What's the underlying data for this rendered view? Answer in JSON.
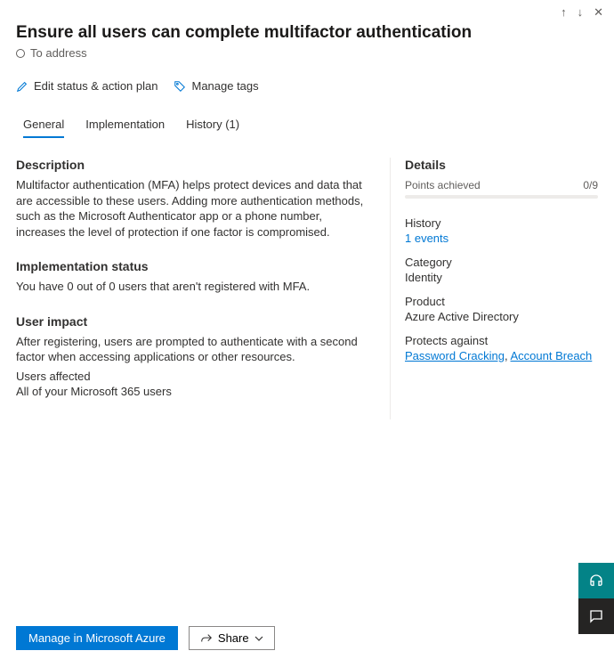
{
  "topbar": {
    "up": "↑",
    "down": "↓",
    "close": "✕"
  },
  "header": {
    "title": "Ensure all users can complete multifactor authentication",
    "status": "To address"
  },
  "actions": {
    "edit": "Edit status & action plan",
    "tags": "Manage tags"
  },
  "tabs": {
    "general": "General",
    "implementation": "Implementation",
    "history": "History (1)"
  },
  "description": {
    "heading": "Description",
    "text": "Multifactor authentication (MFA) helps protect devices and data that are accessible to these users. Adding more authentication methods, such as the Microsoft Authenticator app or a phone number, increases the level of protection if one factor is compromised."
  },
  "implStatus": {
    "heading": "Implementation status",
    "text": "You have 0 out of 0 users that aren't registered with MFA."
  },
  "userImpact": {
    "heading": "User impact",
    "text": "After registering, users are prompted to authenticate with a second factor when accessing applications or other resources.",
    "affectedLabel": "Users affected",
    "affectedValue": "All of your Microsoft 365 users"
  },
  "details": {
    "heading": "Details",
    "pointsLabel": "Points achieved",
    "pointsValue": "0/9",
    "historyLabel": "History",
    "historyLink": "1 events",
    "categoryLabel": "Category",
    "categoryValue": "Identity",
    "productLabel": "Product",
    "productValue": "Azure Active Directory",
    "protectsLabel": "Protects against",
    "protectsLink1": "Password Cracking",
    "protectsSep": ", ",
    "protectsLink2": "Account Breach"
  },
  "footer": {
    "primary": "Manage in Microsoft Azure",
    "share": "Share"
  }
}
